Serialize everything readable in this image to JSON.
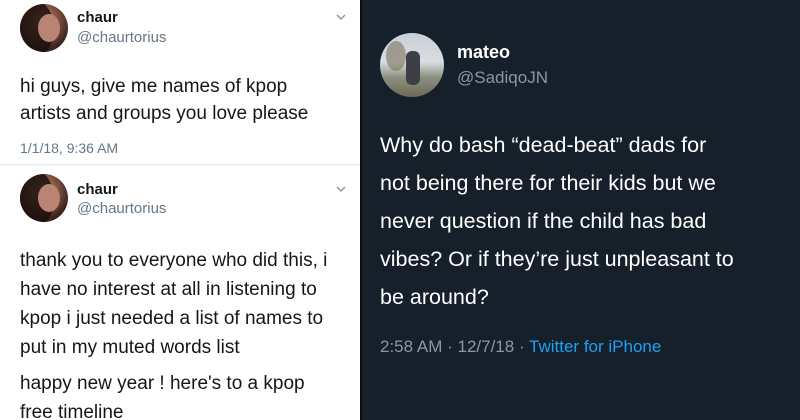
{
  "left_panel": {
    "tweets": [
      {
        "name": "chaur",
        "handle": "@chaurtorius",
        "body": [
          "hi guys, give me names of kpop",
          "artists and groups you love please"
        ],
        "timestamp": "1/1/18, 9:36 AM"
      },
      {
        "name": "chaur",
        "handle": "@chaurtorius",
        "body": [
          "thank you to everyone who did this, i",
          "have no interest at all in listening to",
          "kpop i just needed a list of names to",
          "put in my muted words list"
        ],
        "body2": [
          "happy new year ! here's to a kpop",
          "free timeline"
        ]
      }
    ],
    "background": "#ffffff"
  },
  "right_panel": {
    "name": "mateo",
    "handle": "@SadiqoJN",
    "body": [
      "Why do bash “dead-beat” dads for",
      "not being there for their kids but we",
      "never question if the child has bad",
      "vibes? Or if they’re just unpleasant to",
      "be around?"
    ],
    "time": "2:58 AM",
    "date": "12/7/18",
    "separator": " · ",
    "source": "Twitter for iPhone",
    "background": "#15202b",
    "accent": "#1da1f2"
  },
  "icons": [
    "chevron-down-icon",
    "avatar"
  ]
}
